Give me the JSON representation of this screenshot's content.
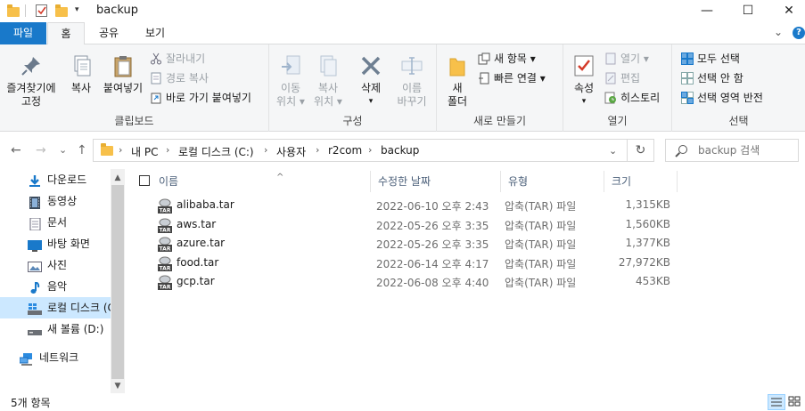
{
  "window": {
    "title": "backup",
    "minimize": "—",
    "maximize": "☐",
    "close": "✕"
  },
  "ribbon_tabs": {
    "file": "파일",
    "home": "홈",
    "share": "공유",
    "view": "보기",
    "expand": "⌄",
    "help": "?"
  },
  "ribbon": {
    "clipboard": {
      "label": "클립보드",
      "pin_line1": "즐겨찾기에",
      "pin_line2": "고정",
      "copy": "복사",
      "paste": "붙여넣기",
      "cut": "잘라내기",
      "copy_path": "경로 복사",
      "paste_shortcut": "바로 가기 붙여넣기"
    },
    "organize": {
      "label": "구성",
      "move_line1": "이동",
      "move_line2": "위치 ▾",
      "copyto_line1": "복사",
      "copyto_line2": "위치 ▾",
      "delete": "삭제",
      "delete_arrow": "▾",
      "rename_line1": "이름",
      "rename_line2": "바꾸기"
    },
    "new": {
      "label": "새로 만들기",
      "folder_line1": "새",
      "folder_line2": "폴더",
      "new_item": "새 항목 ▾",
      "easy_access": "빠른 연결 ▾"
    },
    "open": {
      "label": "열기",
      "properties": "속성",
      "properties_arrow": "▾",
      "open": "열기 ▾",
      "edit": "편집",
      "history": "히스토리"
    },
    "select": {
      "label": "선택",
      "select_all": "모두 선택",
      "select_none": "선택 안 함",
      "invert": "선택 영역 반전"
    }
  },
  "address": {
    "back": "←",
    "forward": "→",
    "recent": "⌄",
    "up": "↑",
    "crumbs": [
      "내 PC",
      "로컬 디스크 (C:)",
      "사용자",
      "r2com",
      "backup"
    ],
    "sep": "›",
    "dropdown": "⌄",
    "refresh": "↻",
    "search_placeholder": "backup 검색"
  },
  "nav": {
    "items": [
      {
        "label": "다운로드"
      },
      {
        "label": "동영상"
      },
      {
        "label": "문서"
      },
      {
        "label": "바탕 화면"
      },
      {
        "label": "사진"
      },
      {
        "label": "음악"
      },
      {
        "label": "로컬 디스크 (C:)"
      },
      {
        "label": "새 볼륨 (D:)"
      },
      {
        "label": "네트워크"
      }
    ],
    "scroll_up": "▲",
    "scroll_down": "▼"
  },
  "table": {
    "headers": [
      "이름",
      "수정한 날짜",
      "유형",
      "크기"
    ],
    "sort_indicator": "^",
    "rows": [
      {
        "name": "alibaba.tar",
        "date": "2022-06-10 오후 2:43",
        "type": "압축(TAR) 파일",
        "size": "1,315KB"
      },
      {
        "name": "aws.tar",
        "date": "2022-05-26 오후 3:35",
        "type": "압축(TAR) 파일",
        "size": "1,560KB"
      },
      {
        "name": "azure.tar",
        "date": "2022-05-26 오후 3:35",
        "type": "압축(TAR) 파일",
        "size": "1,377KB"
      },
      {
        "name": "food.tar",
        "date": "2022-06-14 오후 4:17",
        "type": "압축(TAR) 파일",
        "size": "27,972KB"
      },
      {
        "name": "gcp.tar",
        "date": "2022-06-08 오후 4:40",
        "type": "압축(TAR) 파일",
        "size": "453KB"
      }
    ]
  },
  "status": {
    "count": "5개 항목"
  },
  "colors": {
    "accent": "#1979ca",
    "selected": "#cce8ff",
    "folder": "#f7c04a"
  }
}
